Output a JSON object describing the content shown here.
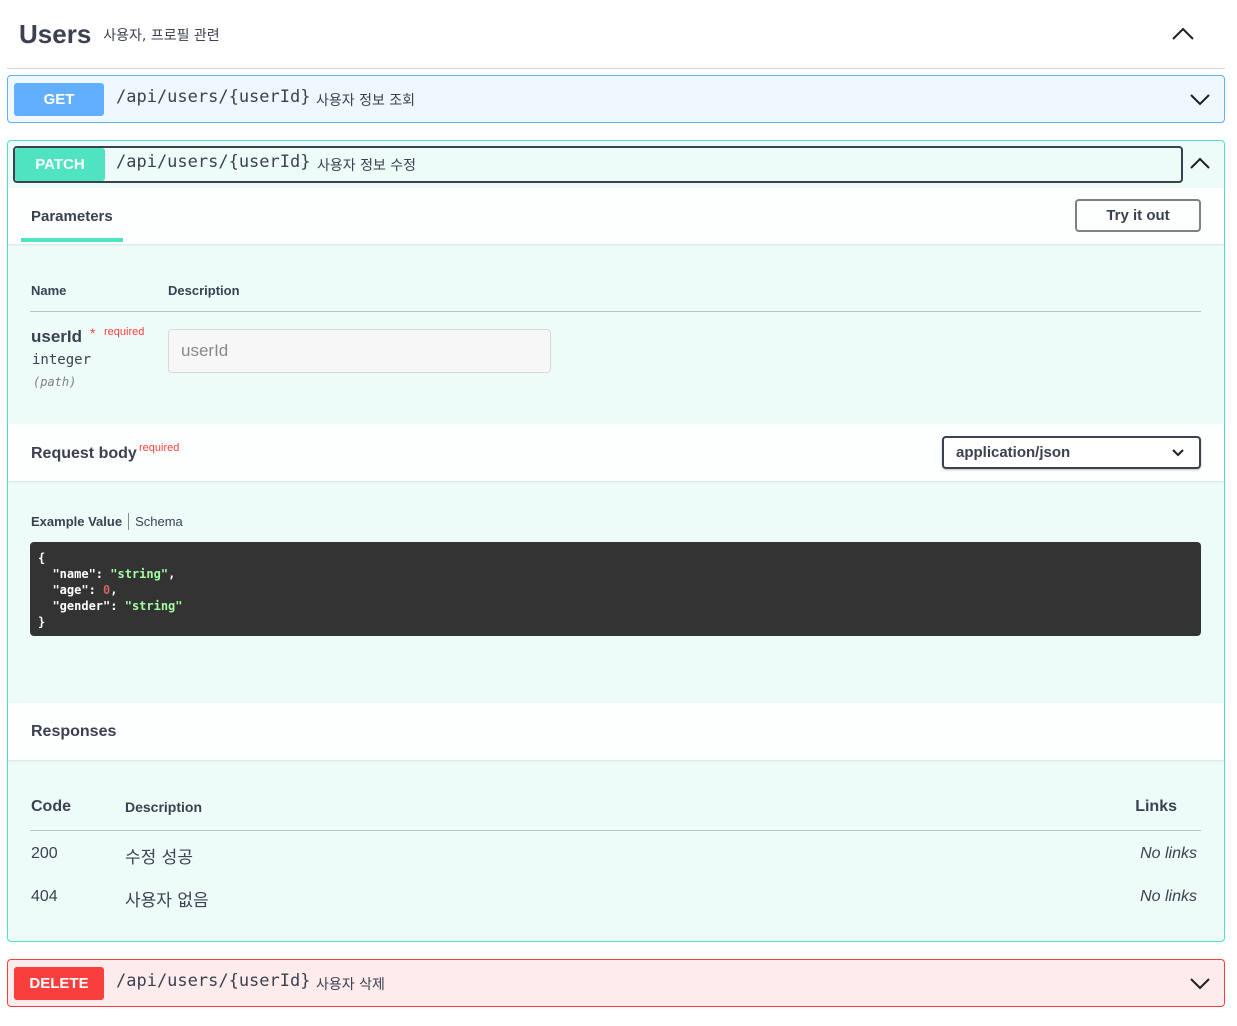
{
  "tag": {
    "title": "Users",
    "description": "사용자, 프로필 관련",
    "toggle_icon": "chevron-up-icon"
  },
  "operations": {
    "get": {
      "method": "GET",
      "path": "/api/users/{userId}",
      "summary": "사용자 정보 조회",
      "color": "#61affe"
    },
    "patch": {
      "method": "PATCH",
      "path": "/api/users/{userId}",
      "summary": "사용자 정보 수정",
      "color": "#50e3c2"
    },
    "delete": {
      "method": "DELETE",
      "path": "/api/users/{userId}",
      "summary": "사용자 삭제",
      "color": "#f93e3e"
    }
  },
  "parameters": {
    "tab_label": "Parameters",
    "try_button": "Try it out",
    "col_name": "Name",
    "col_description": "Description",
    "items": [
      {
        "name": "userId",
        "required_mark": "*",
        "required_label": "required",
        "type": "integer",
        "in": "(path)",
        "placeholder": "userId"
      }
    ]
  },
  "request_body": {
    "title": "Request body",
    "required_label": "required",
    "content_type": "application/json",
    "tab_example": "Example Value",
    "tab_schema": "Schema",
    "example": {
      "name": "string",
      "age": 0,
      "gender": "string"
    }
  },
  "responses": {
    "title": "Responses",
    "col_code": "Code",
    "col_description": "Description",
    "col_links": "Links",
    "rows": [
      {
        "code": "200",
        "description": "수정 성공",
        "links": "No links"
      },
      {
        "code": "404",
        "description": "사용자 없음",
        "links": "No links"
      }
    ]
  }
}
